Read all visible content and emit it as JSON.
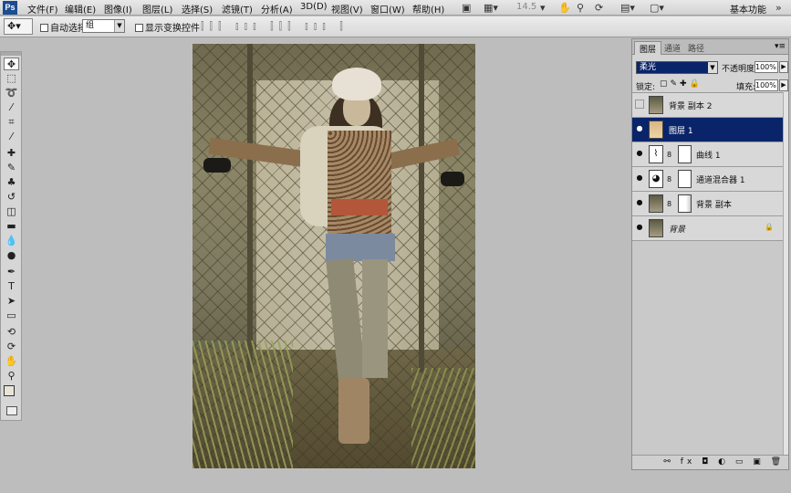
{
  "menubar": {
    "logo": "Ps",
    "items": [
      "文件(F)",
      "编辑(E)",
      "图像(I)",
      "图层(L)",
      "选择(S)",
      "滤镜(T)",
      "分析(A)",
      "3D(D)",
      "视图(V)",
      "窗口(W)",
      "帮助(H)"
    ],
    "zoom": "14.5",
    "workspace": "基本功能"
  },
  "optionsbar": {
    "auto_select_label": "自动选择:",
    "auto_select_value": "组",
    "show_transform_label": "显示变换控件"
  },
  "layers_panel": {
    "tabs": [
      "图层",
      "通道",
      "路径"
    ],
    "blend_mode": "柔光",
    "opacity_label": "不透明度:",
    "opacity_value": "100%",
    "lock_label": "锁定:",
    "fill_label": "填充:",
    "fill_value": "100%",
    "layers": [
      {
        "name": "背景 副本 2",
        "visible": false,
        "selected": false
      },
      {
        "name": "图层 1",
        "visible": true,
        "selected": true
      },
      {
        "name": "曲线 1",
        "visible": true,
        "selected": false
      },
      {
        "name": "通道混合器 1",
        "visible": true,
        "selected": false
      },
      {
        "name": "背景 副本",
        "visible": true,
        "selected": false
      },
      {
        "name": "背景",
        "visible": true,
        "selected": false
      }
    ]
  }
}
